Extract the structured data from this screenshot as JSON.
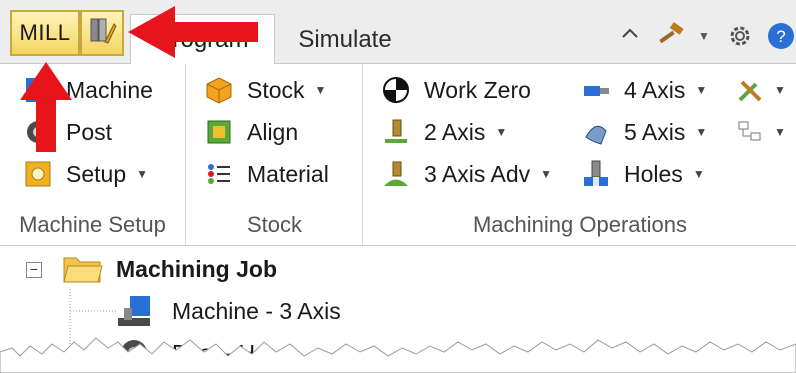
{
  "quick_access": {
    "mill_label": "MILL"
  },
  "tabs": [
    {
      "label": "Program"
    },
    {
      "label": "Simulate"
    }
  ],
  "ribbon": {
    "machine_setup": {
      "label": "Machine Setup",
      "items": [
        {
          "label": "Machine"
        },
        {
          "label": "Post"
        },
        {
          "label": "Setup"
        }
      ]
    },
    "stock": {
      "label": "Stock",
      "items": [
        {
          "label": "Stock"
        },
        {
          "label": "Align"
        },
        {
          "label": "Material"
        }
      ]
    },
    "machining_operations": {
      "label": "Machining Operations",
      "items": [
        {
          "label": "Work Zero"
        },
        {
          "label": "2 Axis"
        },
        {
          "label": "3 Axis Adv"
        },
        {
          "label": "4 Axis"
        },
        {
          "label": "5 Axis"
        },
        {
          "label": "Holes"
        }
      ]
    }
  },
  "tree": {
    "root": {
      "label": "Machining Job"
    },
    "children": [
      {
        "label": "Machine - 3 Axis"
      },
      {
        "label": "Post - Ha"
      }
    ]
  },
  "icons": {
    "toolbar_right": [
      "home-icon",
      "hammer-icon",
      "gear-icon",
      "help-icon"
    ]
  },
  "colors": {
    "highlight": "#f3d560",
    "arrow": "#e8141c",
    "accent": "#2a6fd6"
  }
}
